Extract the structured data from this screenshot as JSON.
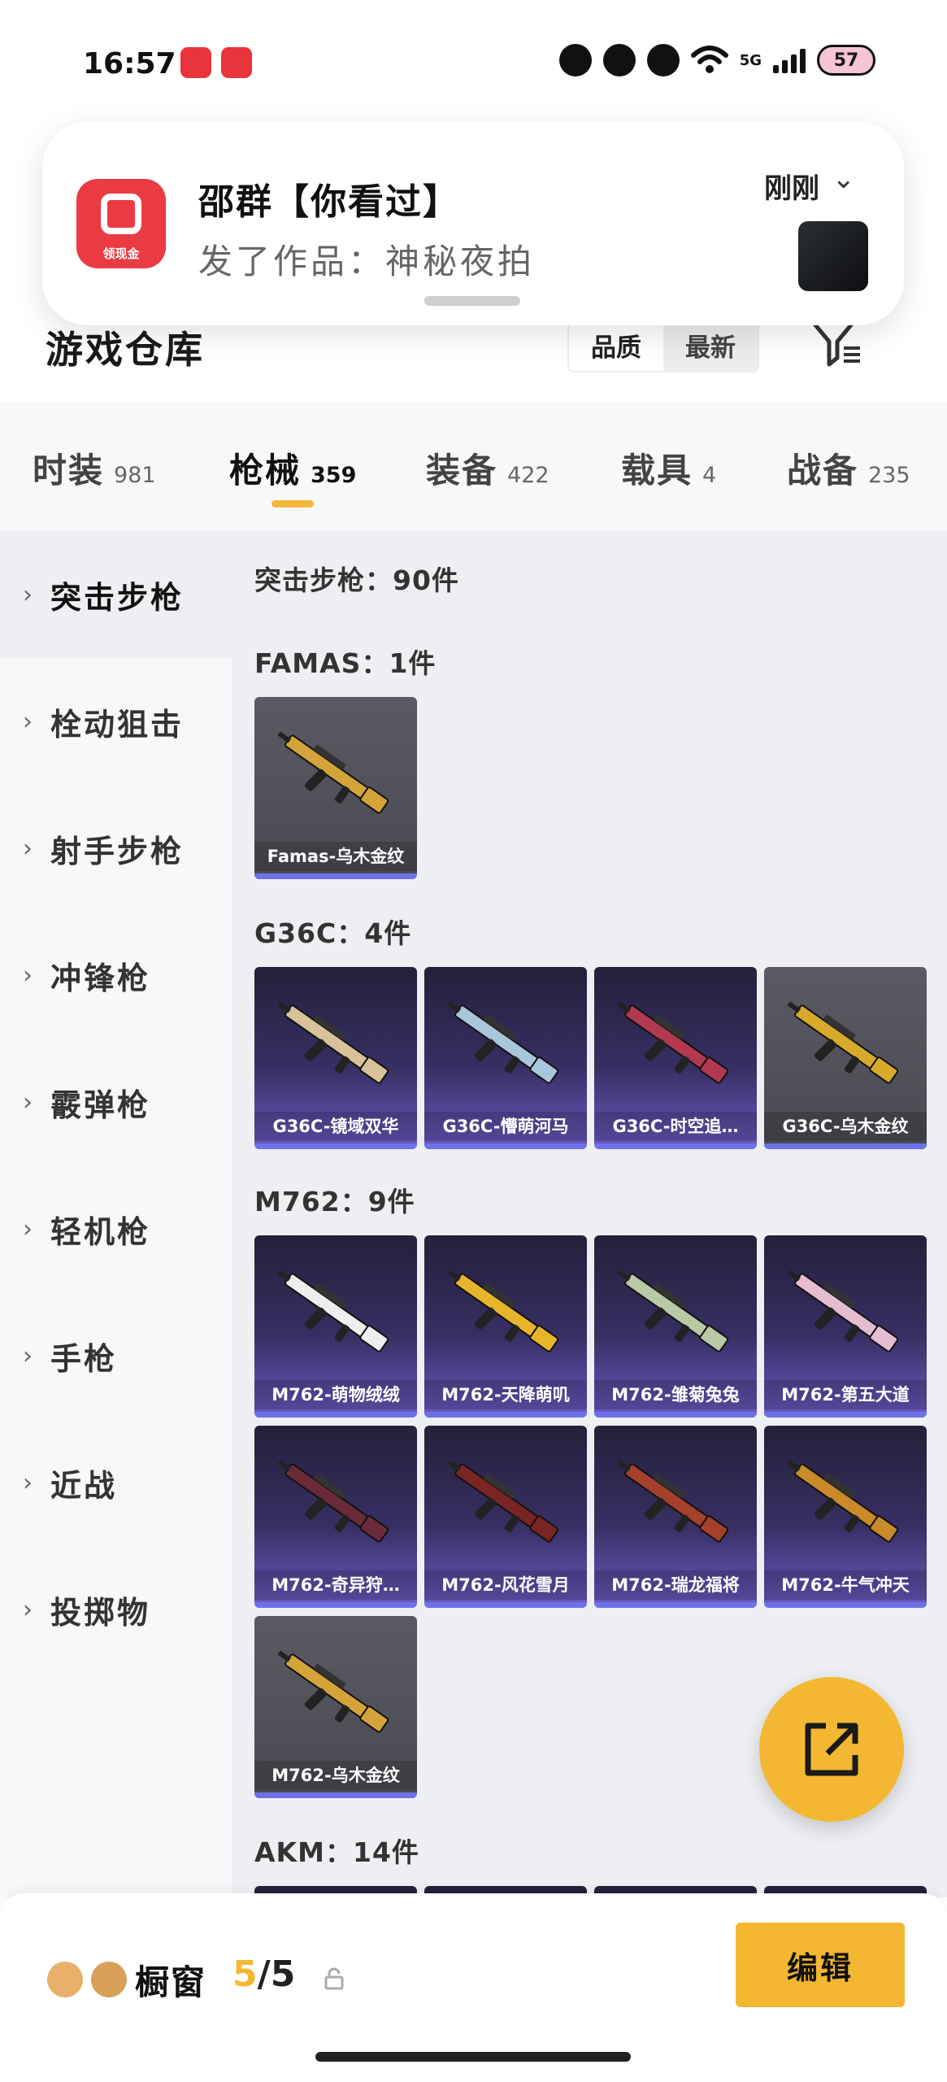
{
  "status_bar": {
    "time": "16:57",
    "network": "5G",
    "battery": "57",
    "icons": [
      "kuaishou-app-icon",
      "heart-app-icon",
      "flower-icon",
      "bear-icon",
      "paw-icon",
      "wifi-icon",
      "signal-icon",
      "battery-icon"
    ]
  },
  "notification": {
    "app_label": "领现金",
    "title": "邵群【你看过】",
    "body": "发了作品：神秘夜拍",
    "time": "刚刚"
  },
  "header": {
    "title": "游戏仓库",
    "sort_options": [
      "品质",
      "最新"
    ],
    "active_sort": "品质"
  },
  "tabs": [
    {
      "label": "时装",
      "count": "981"
    },
    {
      "label": "枪械",
      "count": "359"
    },
    {
      "label": "装备",
      "count": "422"
    },
    {
      "label": "载具",
      "count": "4"
    },
    {
      "label": "战备",
      "count": "235"
    }
  ],
  "active_tab": "枪械",
  "sidebar": {
    "items": [
      "突击步枪",
      "栓动狙击",
      "射手步枪",
      "冲锋枪",
      "霰弹枪",
      "轻机枪",
      "手枪",
      "近战",
      "投掷物"
    ],
    "active": "突击步枪"
  },
  "content": {
    "category_title": "突击步枪：90件",
    "groups": [
      {
        "title": "FAMAS：1件",
        "items": [
          {
            "name": "Famas-乌木金纹",
            "style": "grey",
            "gun_color": "#d4a43a"
          }
        ]
      },
      {
        "title": "G36C：4件",
        "items": [
          {
            "name": "G36C-镜域双华",
            "style": "purple",
            "gun_color": "#d9c19a"
          },
          {
            "name": "G36C-懵萌河马",
            "style": "purple",
            "gun_color": "#a9c7da"
          },
          {
            "name": "G36C-时空追…",
            "style": "purple",
            "gun_color": "#b2394f"
          },
          {
            "name": "G36C-乌木金纹",
            "style": "grey",
            "gun_color": "#d8aa2c"
          }
        ]
      },
      {
        "title": "M762：9件",
        "items": [
          {
            "name": "M762-萌物绒绒",
            "style": "purple",
            "gun_color": "#eeeeee"
          },
          {
            "name": "M762-天降萌叽",
            "style": "purple",
            "gun_color": "#e6b52c"
          },
          {
            "name": "M762-雏菊兔兔",
            "style": "purple",
            "gun_color": "#b9c9a6"
          },
          {
            "name": "M762-第五大道",
            "style": "purple",
            "gun_color": "#e6bcd0"
          },
          {
            "name": "M762-奇异狩…",
            "style": "purple",
            "gun_color": "#6a2a3a"
          },
          {
            "name": "M762-风花雪月",
            "style": "purple",
            "gun_color": "#7a2424"
          },
          {
            "name": "M762-瑞龙福将",
            "style": "purple",
            "gun_color": "#a5402a"
          },
          {
            "name": "M762-牛气冲天",
            "style": "purple",
            "gun_color": "#c98a2a"
          },
          {
            "name": "M762-乌木金纹",
            "style": "grey",
            "gun_color": "#d4a43a"
          }
        ]
      },
      {
        "title": "AKM：14件",
        "items": []
      }
    ]
  },
  "bottom_bar": {
    "label": "橱窗",
    "current": "5",
    "separator": "/",
    "max": "5",
    "edit_button": "编辑"
  },
  "colors": {
    "accent": "#f3b731",
    "card_purple": "#372f63",
    "card_grey": "#4a4a52",
    "card_bar": "#6d72e8"
  }
}
